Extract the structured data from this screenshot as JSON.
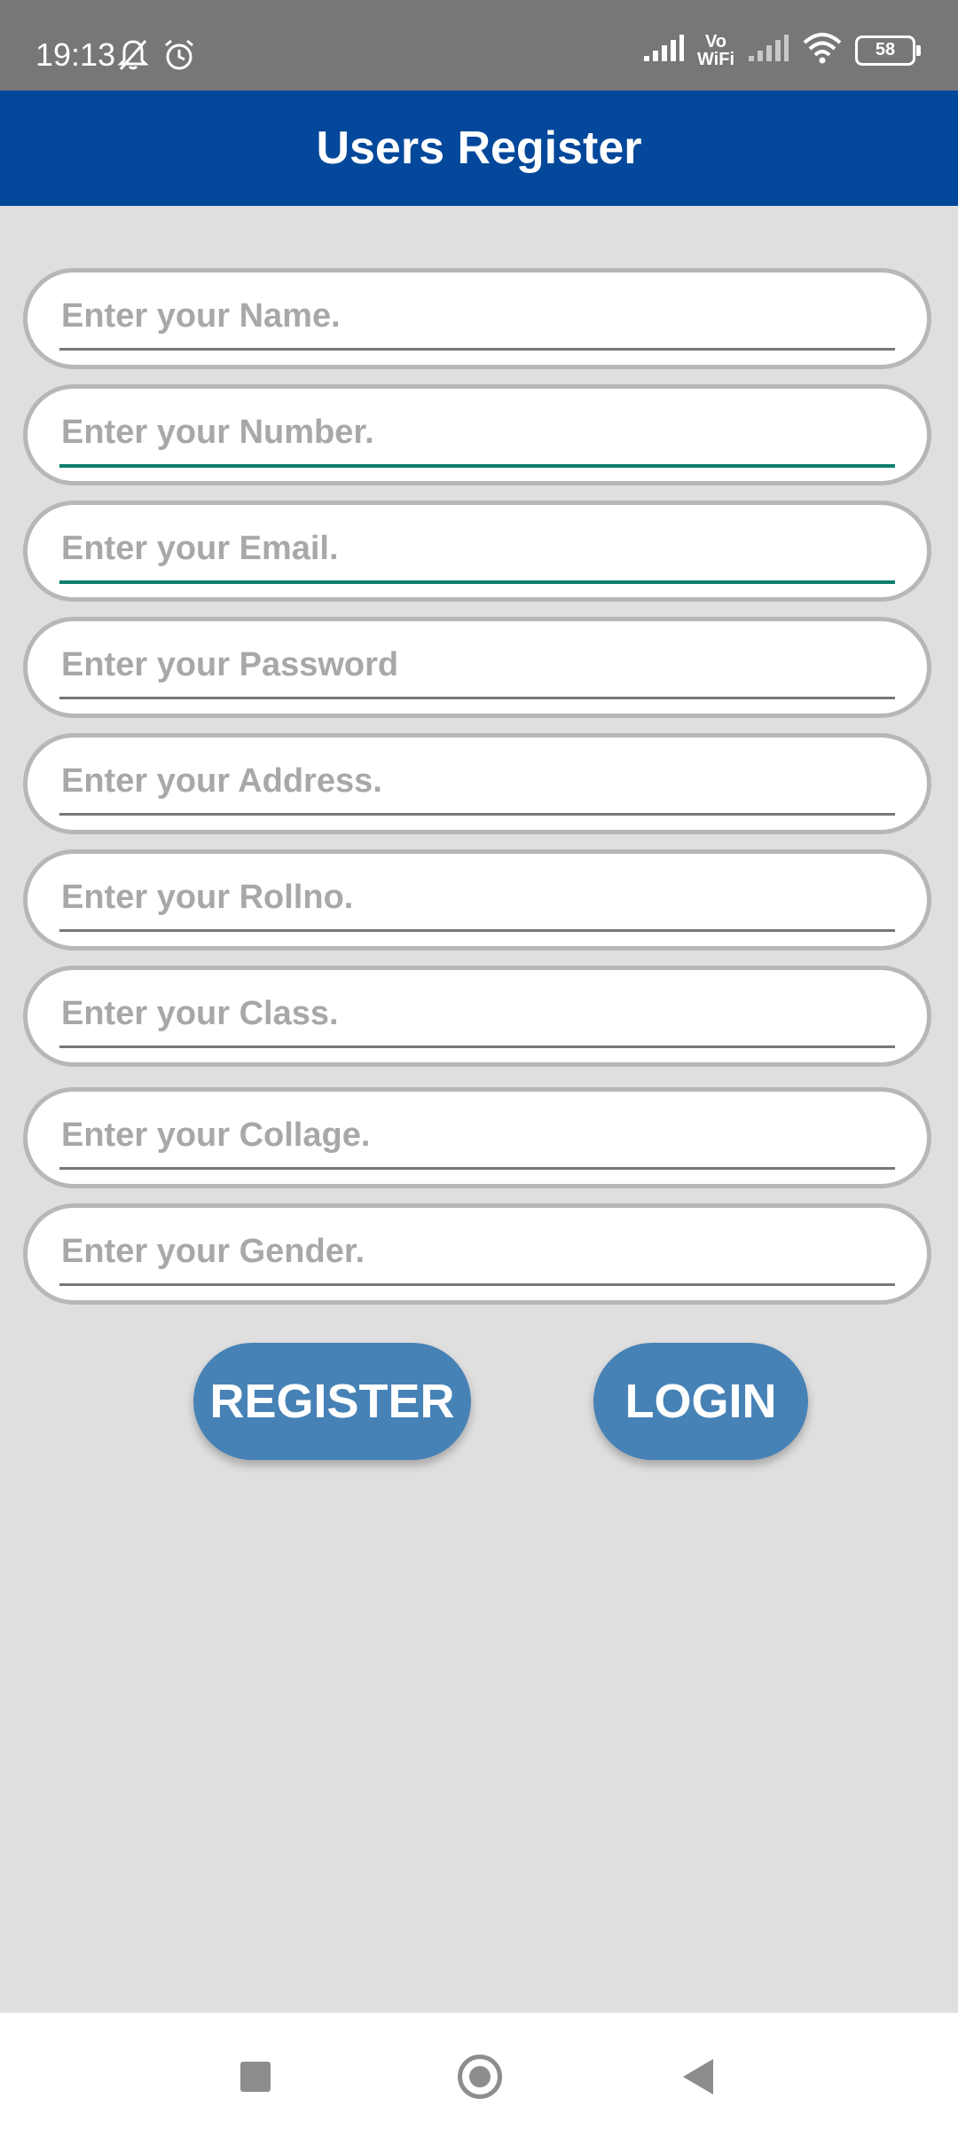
{
  "status_bar": {
    "time": "19:13",
    "vowifi_top": "Vo",
    "vowifi_bottom": "WiFi",
    "battery": "58"
  },
  "app_bar": {
    "title": "Users Register"
  },
  "form": {
    "fields": [
      {
        "placeholder": "Enter your Name.",
        "value": ""
      },
      {
        "placeholder": "Enter your Number.",
        "value": ""
      },
      {
        "placeholder": "Enter your Email.",
        "value": ""
      },
      {
        "placeholder": "Enter your Password",
        "value": ""
      },
      {
        "placeholder": "Enter your Address.",
        "value": ""
      },
      {
        "placeholder": "Enter your Rollno.",
        "value": ""
      },
      {
        "placeholder": "Enter your Class.",
        "value": ""
      },
      {
        "placeholder": "Enter your Collage.",
        "value": ""
      },
      {
        "placeholder": "Enter your Gender.",
        "value": ""
      }
    ]
  },
  "buttons": {
    "register": "REGISTER",
    "login": "LOGIN"
  },
  "colors": {
    "app_bar": "#03489b",
    "status_bar": "#777777",
    "background": "#dfdfe0",
    "button": "#4682b6",
    "focus_underline": "#0f7e6c"
  },
  "icons": [
    "bell-off-icon",
    "alarm-icon",
    "signal-icon",
    "wifi-icon",
    "battery-icon",
    "recents-icon",
    "home-icon",
    "back-icon"
  ]
}
